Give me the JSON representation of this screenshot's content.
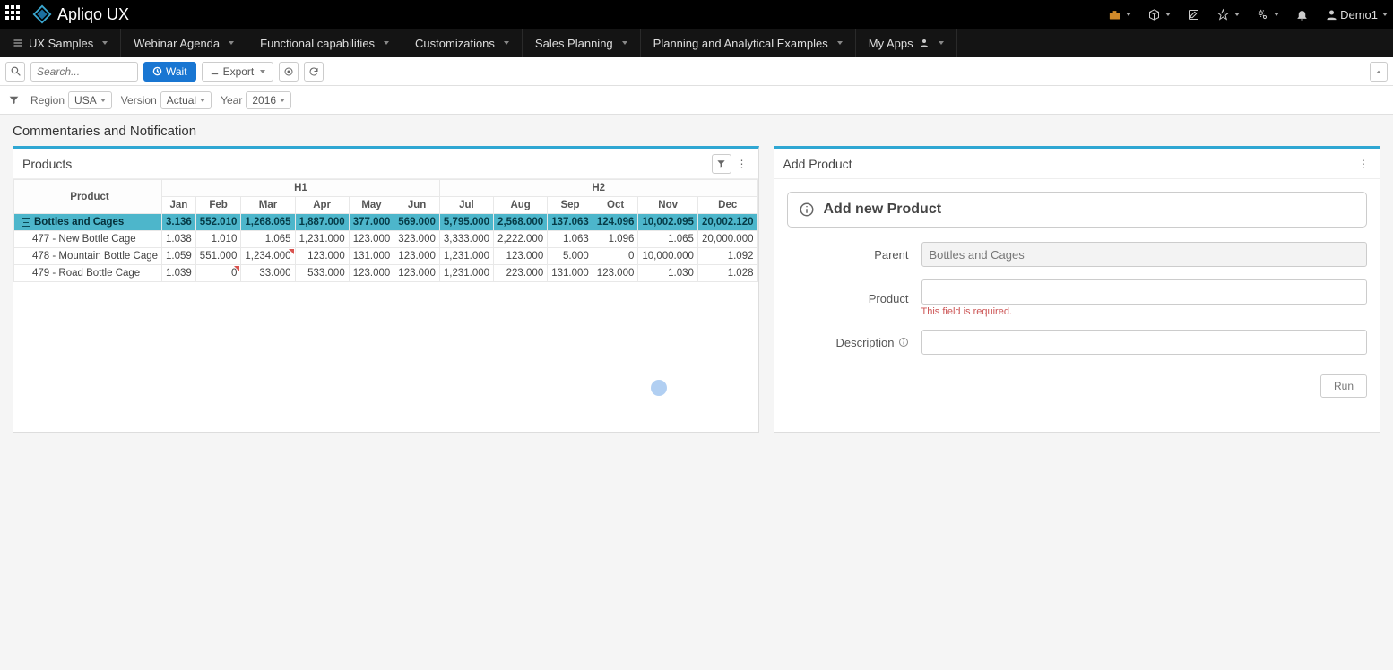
{
  "top": {
    "brand": "Apliqo UX",
    "user": "Demo1"
  },
  "nav": {
    "items": [
      "UX Samples",
      "Webinar Agenda",
      "Functional capabilities",
      "Customizations",
      "Sales Planning",
      "Planning and Analytical Examples",
      "My Apps"
    ]
  },
  "toolbar": {
    "search_placeholder": "Search...",
    "wait_label": "Wait",
    "export_label": "Export"
  },
  "filters": {
    "region_label": "Region",
    "region_value": "USA",
    "version_label": "Version",
    "version_value": "Actual",
    "year_label": "Year",
    "year_value": "2016"
  },
  "page_title": "Commentaries and Notification",
  "left_panel": {
    "title": "Products",
    "half_headers": [
      "H1",
      "H2"
    ],
    "months": [
      "Jan",
      "Feb",
      "Mar",
      "Apr",
      "May",
      "Jun",
      "Jul",
      "Aug",
      "Sep",
      "Oct",
      "Nov",
      "Dec"
    ],
    "product_header": "Product",
    "summary": {
      "name": "Bottles and Cages",
      "vals": [
        "3.136",
        "552.010",
        "1,268.065",
        "1,887.000",
        "377.000",
        "569.000",
        "5,795.000",
        "2,568.000",
        "137.063",
        "124.096",
        "10,002.095",
        "20,002.120"
      ]
    },
    "rows": [
      {
        "name": "477 - New Bottle Cage",
        "vals": [
          "1.038",
          "1.010",
          "1.065",
          "1,231.000",
          "123.000",
          "323.000",
          "3,333.000",
          "2,222.000",
          "1.063",
          "1.096",
          "1.065",
          "20,000.000"
        ]
      },
      {
        "name": "478 - Mountain Bottle Cage",
        "vals": [
          "1.059",
          "551.000",
          "1,234.000",
          "123.000",
          "131.000",
          "123.000",
          "1,231.000",
          "123.000",
          "5.000",
          "0",
          "10,000.000",
          "1.092"
        ]
      },
      {
        "name": "479 - Road Bottle Cage",
        "vals": [
          "1.039",
          "0",
          "33.000",
          "533.000",
          "123.000",
          "123.000",
          "1,231.000",
          "223.000",
          "131.000",
          "123.000",
          "1.030",
          "1.028"
        ]
      }
    ]
  },
  "right_panel": {
    "title": "Add Product",
    "notice": "Add new Product",
    "parent_label": "Parent",
    "parent_value": "Bottles and Cages",
    "product_label": "Product",
    "product_error": "This field is required.",
    "description_label": "Description",
    "run_label": "Run"
  }
}
